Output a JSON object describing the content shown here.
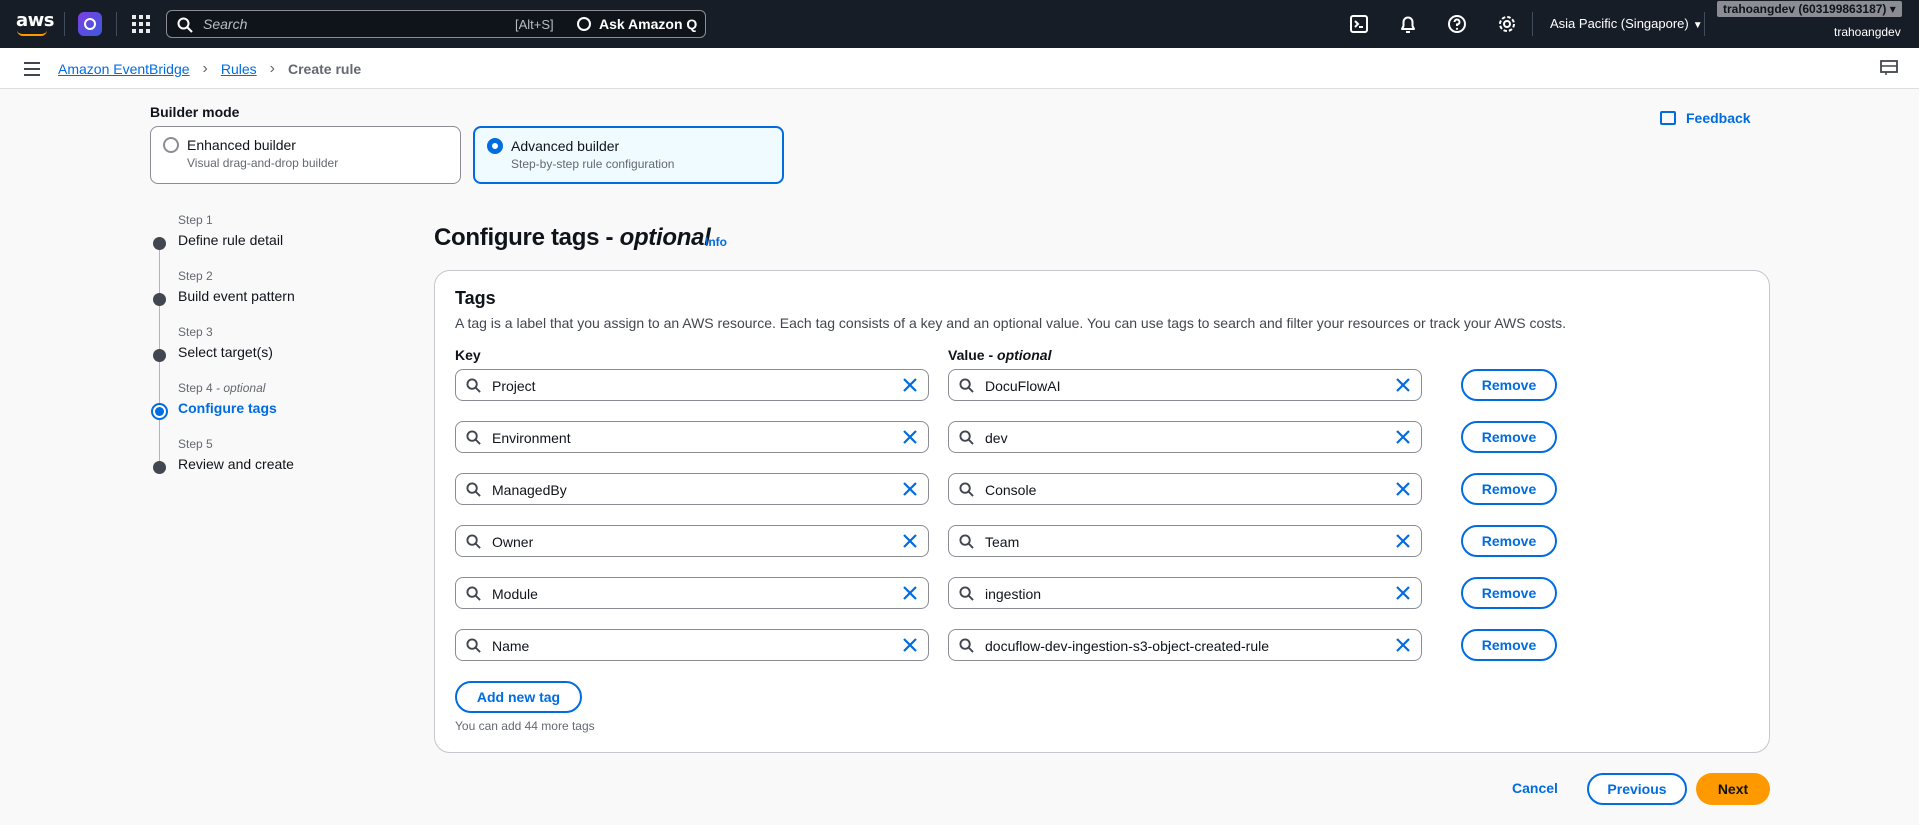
{
  "topnav": {
    "logo_text": "aws",
    "search_placeholder": "Search",
    "search_shortcut": "[Alt+S]",
    "ask_q_label": "Ask Amazon Q",
    "region": "Asia Pacific (Singapore)",
    "account_badge": "trahoangdev (603199863187)",
    "account_user": "trahoangdev",
    "icons": [
      "cloudshell-icon",
      "bell-icon",
      "help-icon",
      "gear-icon"
    ]
  },
  "breadcrumb": {
    "items": [
      "Amazon EventBridge",
      "Rules"
    ],
    "current": "Create rule",
    "separator": ">"
  },
  "builder_mode": {
    "label": "Builder mode",
    "options": [
      {
        "title": "Enhanced builder",
        "desc": "Visual drag-and-drop builder",
        "selected": false
      },
      {
        "title": "Advanced builder",
        "desc": "Step-by-step rule configuration",
        "selected": true
      }
    ]
  },
  "feedback_label": "Feedback",
  "steps": [
    {
      "num": "Step 1",
      "optional": "",
      "name": "Define rule detail",
      "active": false
    },
    {
      "num": "Step 2",
      "optional": "",
      "name": "Build event pattern",
      "active": false
    },
    {
      "num": "Step 3",
      "optional": "",
      "name": "Select target(s)",
      "active": false
    },
    {
      "num": "Step 4",
      "optional": "- optional",
      "name": "Configure tags",
      "active": true
    },
    {
      "num": "Step 5",
      "optional": "",
      "name": "Review and create",
      "active": false
    }
  ],
  "page": {
    "title": "Configure tags",
    "title_optional": "optional",
    "title_sep": " - ",
    "info": "Info"
  },
  "tags": {
    "heading": "Tags",
    "description": "A tag is a label that you assign to an AWS resource. Each tag consists of a key and an optional value. You can use tags to search and filter your resources or track your AWS costs.",
    "key_header": "Key",
    "value_header": "Value - ",
    "value_header_optional": "optional",
    "remove_label": "Remove",
    "rows": [
      {
        "key": "Project",
        "value": "DocuFlowAI"
      },
      {
        "key": "Environment",
        "value": "dev"
      },
      {
        "key": "ManagedBy",
        "value": "Console"
      },
      {
        "key": "Owner",
        "value": "Team"
      },
      {
        "key": "Module",
        "value": "ingestion"
      },
      {
        "key": "Name",
        "value": "docuflow-dev-ingestion-s3-object-created-rule"
      }
    ],
    "add_label": "Add new tag",
    "limit_text": "You can add 44 more tags"
  },
  "footer": {
    "cancel": "Cancel",
    "previous": "Previous",
    "next": "Next"
  },
  "colors": {
    "accent": "#006ce0",
    "primary_button": "#ff9900",
    "nav_bg": "#161d26"
  }
}
